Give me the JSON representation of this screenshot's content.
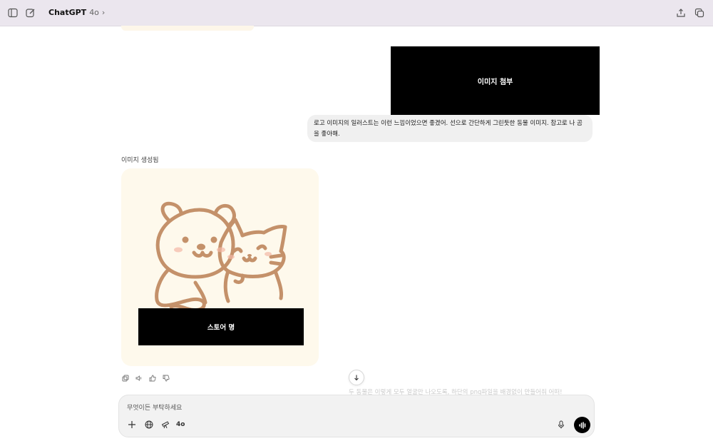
{
  "header": {
    "title": "ChatGPT",
    "model": "4o",
    "icons": [
      "sidebar-toggle-icon",
      "new-chat-icon",
      "share-icon",
      "temporary-chat-icon"
    ]
  },
  "user_message": {
    "attachment_label": "이미지 첨부",
    "text": "로고 이미지의 일러스트는 이런 느낌이었으면 좋겠어. 선으로 간단하게 그린듯한 동물 이미지. 참고로 나 곰을 좋아해."
  },
  "assistant_message": {
    "status_label": "이미지 생성됨",
    "store_label": "스토어 명",
    "action_icons": [
      "copy-icon",
      "read-aloud-icon",
      "thumbs-up-icon",
      "thumbs-down-icon"
    ]
  },
  "faded_text": "두 동물은 이렇게 모두 얼굴만 나오도록, 하단의 png파일을 배경없이 만들어줘 어떠!",
  "composer": {
    "placeholder": "무엇이든 부탁하세요",
    "model": "4o"
  },
  "colors": {
    "topbar": "#ebe6ee",
    "illustration_bg": "#fef9ec",
    "line_art": "#c4916a"
  }
}
